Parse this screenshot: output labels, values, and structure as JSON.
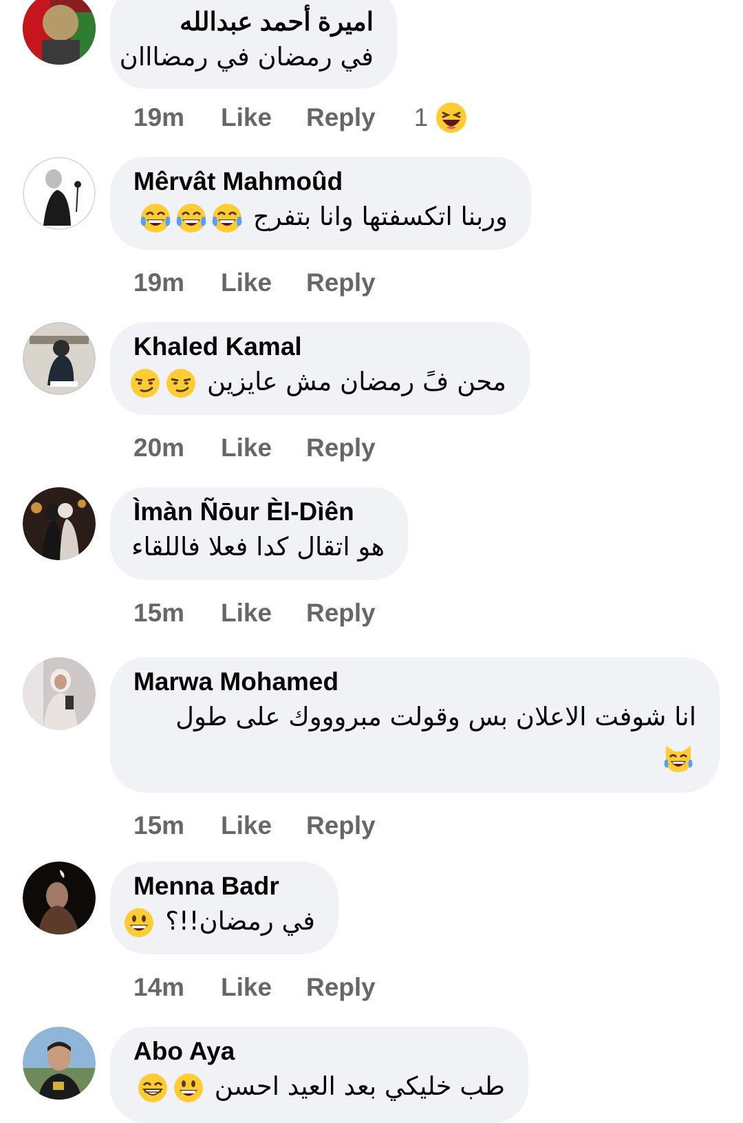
{
  "comments": [
    {
      "author": "اميرة أحمد عبدالله",
      "text": "في رمضان في رمضااان",
      "time": "19m",
      "like": "Like",
      "reply": "Reply",
      "reaction_count": "1"
    },
    {
      "author": "Mêrvât Mahmoûd",
      "text": "وربنا اتكسفتها وانا بتفرج",
      "time": "19m",
      "like": "Like",
      "reply": "Reply"
    },
    {
      "author": "Khaled Kamal",
      "text": "محن فً رمضان مش عايزين",
      "time": "20m",
      "like": "Like",
      "reply": "Reply"
    },
    {
      "author": "Ìmàn Ñōur Èl-Dìên",
      "text": "هو اتقال كدا فعلا فاللقاء",
      "time": "15m",
      "like": "Like",
      "reply": "Reply"
    },
    {
      "author": "Marwa Mohamed",
      "text": "انا شوفت الاعلان بس وقولت مبروووك على طول",
      "time": "15m",
      "like": "Like",
      "reply": "Reply"
    },
    {
      "author": "Menna Badr",
      "text": "في رمضان!!؟",
      "time": "14m",
      "like": "Like",
      "reply": "Reply"
    },
    {
      "author": "Abo Aya",
      "text": "طب خليكي بعد العيد احسن",
      "time": "",
      "like": "",
      "reply": ""
    }
  ],
  "icons": {
    "reaction": "haha-laughing-emoji",
    "tears_of_joy": "face-with-tears-of-joy-emoji",
    "smirk": "smirking-face-emoji",
    "cat": "cat-with-tears-of-joy-emoji",
    "grin": "grinning-face-emoji",
    "beam": "beaming-face-emoji"
  },
  "colors": {
    "bubble_bg": "#f0f2f5",
    "meta_text": "#65676b",
    "author_text": "#050505",
    "emoji_yellow": "#ffcc33"
  }
}
